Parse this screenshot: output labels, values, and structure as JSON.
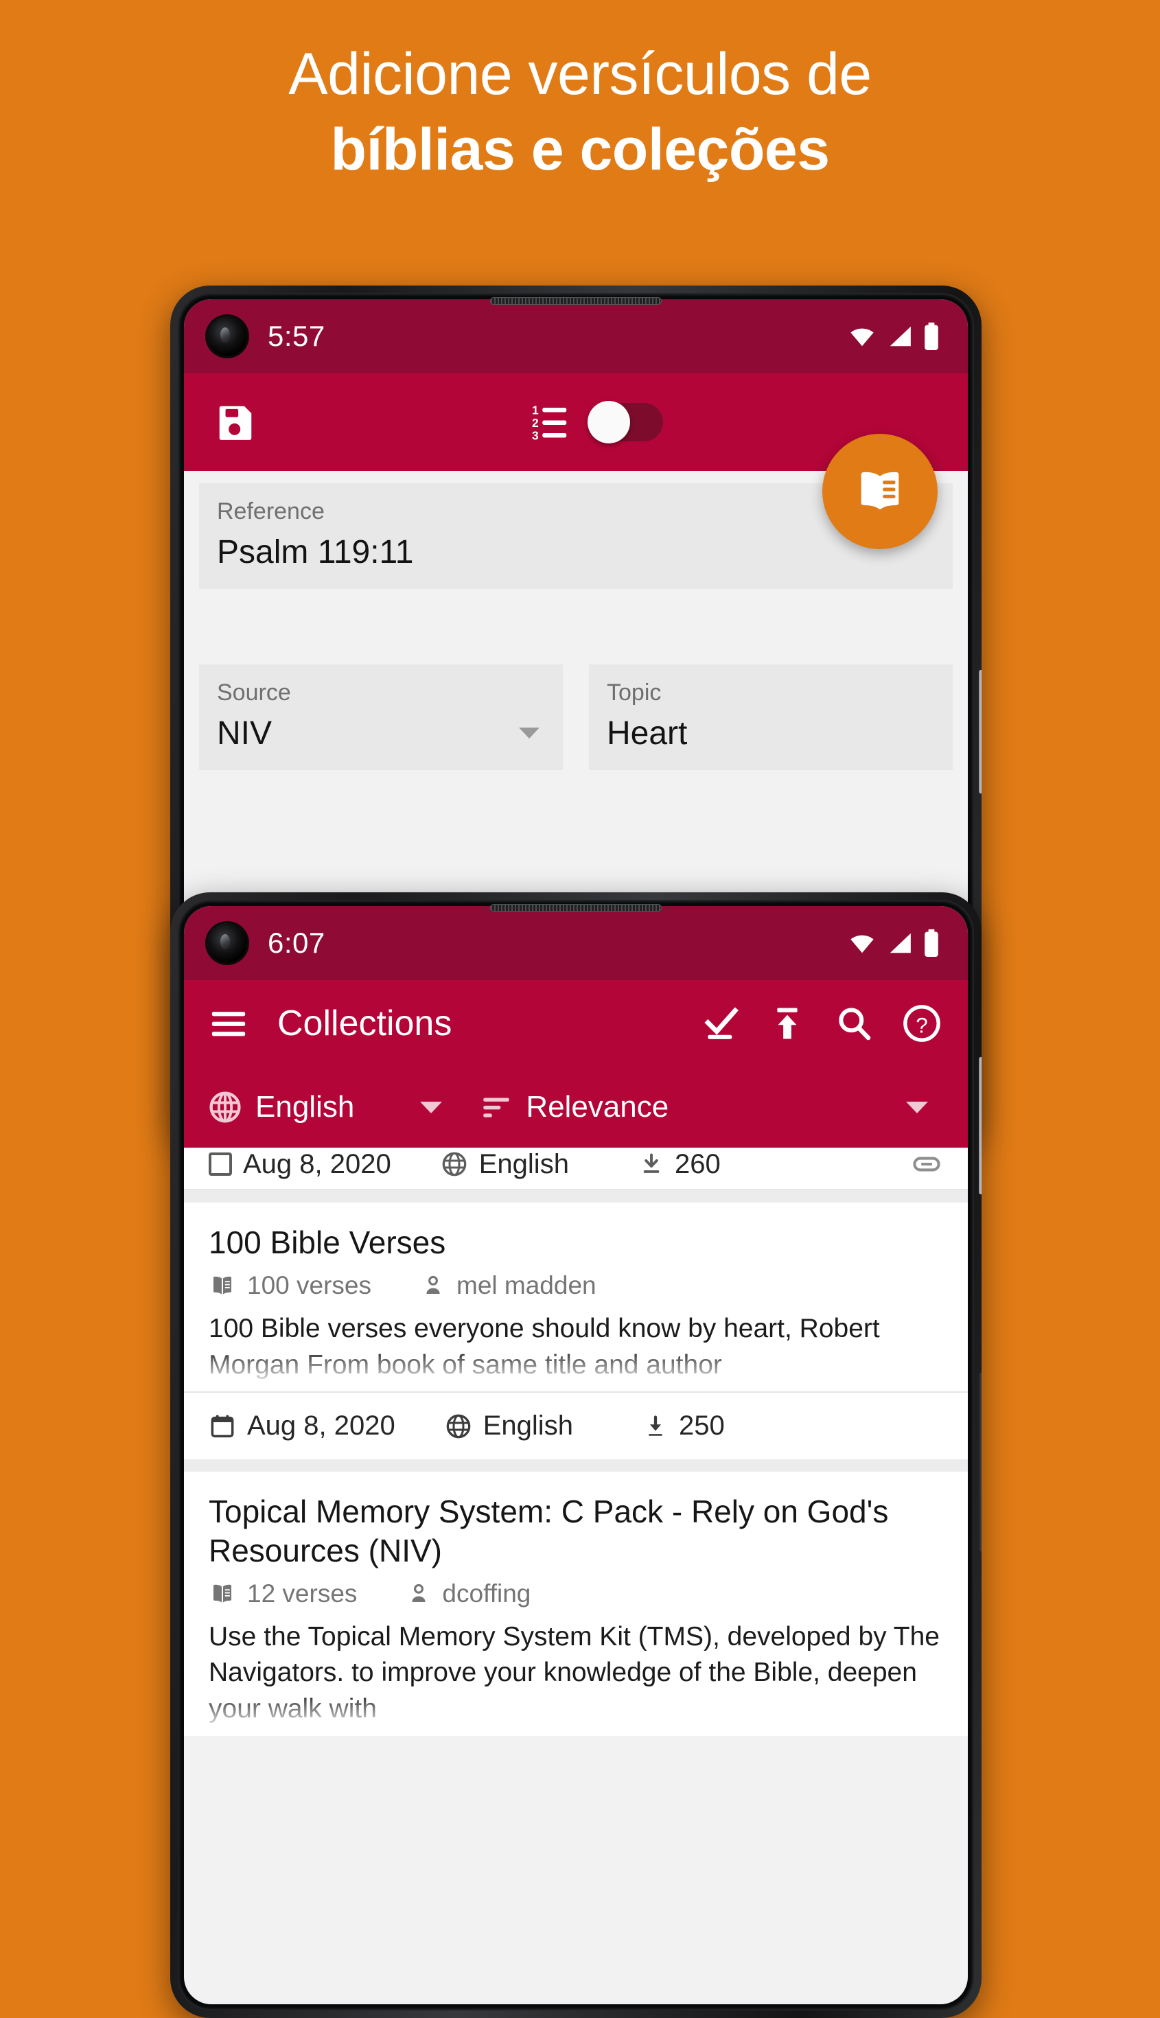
{
  "promo": {
    "headline_line1": "Adicione versículos de",
    "headline_line2": "bíblias e coleções",
    "background_color": "#e07b16"
  },
  "colors": {
    "brand_orange": "#e07b16",
    "appbar_crimson": "#b30538",
    "statusbar_maroon": "#8f0b36",
    "card_white": "#ffffff",
    "field_grey": "#e8e8e8"
  },
  "phone_top": {
    "status_bar": {
      "time": "5:57",
      "icons": [
        "wifi-icon",
        "cell-signal-icon",
        "battery-icon"
      ]
    },
    "app_bar": {
      "save_icon": "save-floppy-icon",
      "numbered_list_icon": "numbered-list-icon",
      "toggle_state": "off"
    },
    "fab": {
      "icon": "open-book-icon",
      "color": "#e07b16"
    },
    "form": {
      "reference": {
        "label": "Reference",
        "value": "Psalm 119:11"
      },
      "source": {
        "label": "Source",
        "value": "NIV",
        "caret": "dropdown-caret"
      },
      "topic": {
        "label": "Topic",
        "value": "Heart"
      }
    }
  },
  "phone_bottom": {
    "status_bar": {
      "time": "6:07",
      "icons": [
        "wifi-icon",
        "cell-signal-icon",
        "battery-icon"
      ]
    },
    "app_bar": {
      "menu_icon": "hamburger-menu-icon",
      "title": "Collections",
      "actions": [
        "select-check-icon",
        "upload-icon",
        "search-icon",
        "help-icon"
      ]
    },
    "filters": {
      "language": {
        "icon": "globe-icon",
        "value": "English"
      },
      "sort": {
        "icon": "sort-icon",
        "value": "Relevance"
      }
    },
    "partial_row": {
      "date": "Aug 8, 2020",
      "language": "English",
      "downloads": "260",
      "trailing_icon": "link-icon"
    },
    "cards": [
      {
        "title": "100 Bible Verses",
        "verses": "100 verses",
        "author": "mel madden",
        "description": "100 Bible verses everyone should know by heart, Robert Morgan From book of same title and author",
        "date": "Aug 8, 2020",
        "language": "English",
        "downloads": "250"
      },
      {
        "title": "Topical Memory System: C Pack - Rely on God's Resources (NIV)",
        "verses": "12 verses",
        "author": "dcoffing",
        "description": "Use the Topical Memory System Kit (TMS), developed by The Navigators. to improve your knowledge of the Bible, deepen your walk with",
        "date": "",
        "language": "",
        "downloads": ""
      }
    ]
  }
}
